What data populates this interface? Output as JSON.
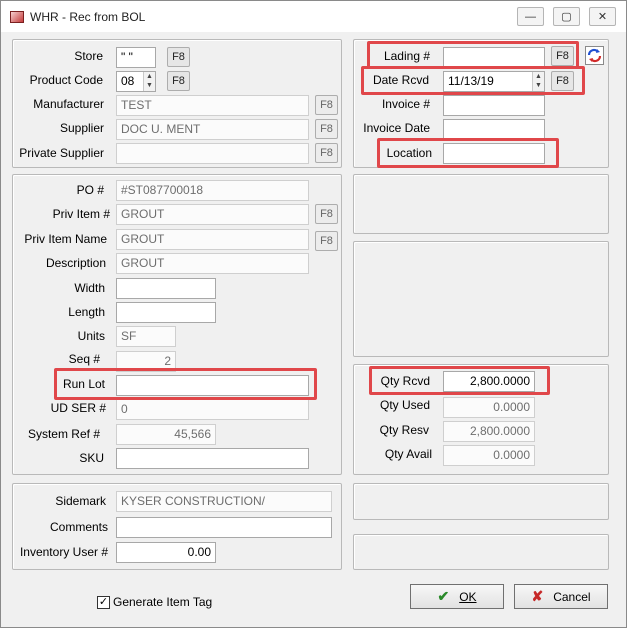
{
  "window": {
    "title": "WHR - Rec from BOL",
    "min": "—",
    "max": "▢",
    "close": "✕"
  },
  "f8": "F8",
  "top_left": {
    "store_label": "Store",
    "store_value": "\" \"",
    "product_code_label": "Product Code",
    "product_code_value": "08",
    "manufacturer_label": "Manufacturer",
    "manufacturer_value": "TEST",
    "supplier_label": "Supplier",
    "supplier_value": "DOC U. MENT",
    "private_supplier_label": "Private Supplier",
    "private_supplier_value": ""
  },
  "top_right": {
    "lading_label": "Lading #",
    "lading_value": "",
    "date_rcvd_label": "Date Rcvd",
    "date_rcvd_value": "11/13/19",
    "invoice_label": "Invoice #",
    "invoice_value": "",
    "invoice_date_label": "Invoice Date",
    "invoice_date_value": "",
    "location_label": "Location",
    "location_value": ""
  },
  "item": {
    "po_label": "PO #",
    "po_value": "#ST087700018",
    "priv_item_label": "Priv Item #",
    "priv_item_value": "GROUT",
    "priv_item_name_label": "Priv Item Name",
    "priv_item_name_value": "GROUT",
    "description_label": "Description",
    "description_value": "GROUT",
    "width_label": "Width",
    "width_value": "",
    "length_label": "Length",
    "length_value": "",
    "units_label": "Units",
    "units_value": "SF",
    "seq_label": "Seq #",
    "seq_value": "2",
    "run_lot_label": "Run Lot",
    "run_lot_value": "",
    "ud_ser_label": "UD SER #",
    "ud_ser_value": "0",
    "system_ref_label": "System Ref #",
    "system_ref_value": "45,566",
    "sku_label": "SKU",
    "sku_value": ""
  },
  "qty": {
    "rcvd_label": "Qty Rcvd",
    "rcvd_value": "2,800.0000",
    "used_label": "Qty Used",
    "used_value": "0.0000",
    "resv_label": "Qty Resv",
    "resv_value": "2,800.0000",
    "avail_label": "Qty Avail",
    "avail_value": "0.0000"
  },
  "bottom": {
    "sidemark_label": "Sidemark",
    "sidemark_value": "KYSER CONSTRUCTION/",
    "comments_label": "Comments",
    "comments_value": "",
    "inventory_user_label": "Inventory User #",
    "inventory_user_value": "0.00",
    "generate_tag_label": "Generate Item Tag",
    "generate_tag_checked": "✓"
  },
  "buttons": {
    "ok": "OK",
    "ok_icon": "✔",
    "cancel": "Cancel",
    "cancel_icon": "✘"
  },
  "colors": {
    "highlight": "#e0474a",
    "ok_check": "#2a8a2a",
    "cancel_x": "#c62828"
  }
}
